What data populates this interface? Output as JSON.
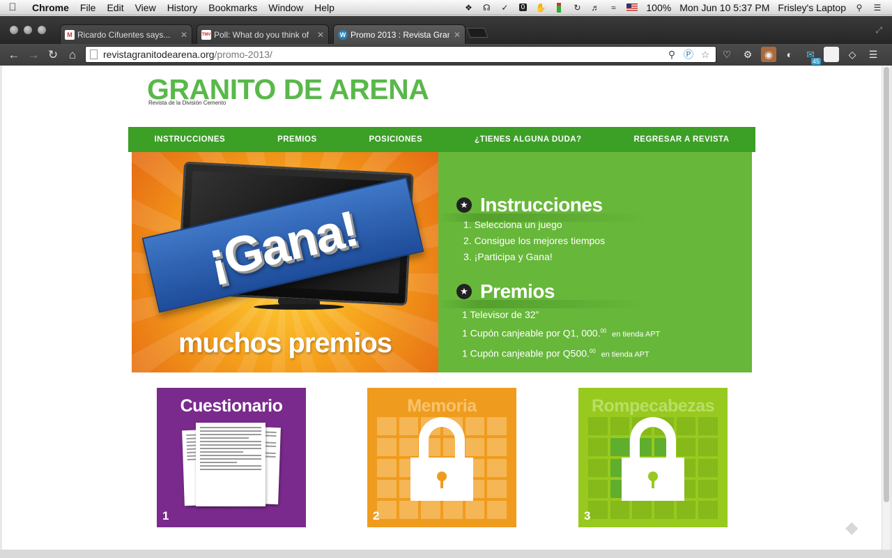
{
  "menubar": {
    "app": "Chrome",
    "items": [
      "File",
      "Edit",
      "View",
      "History",
      "Bookmarks",
      "Window",
      "Help"
    ],
    "status_icons": [
      "dropbox-icon",
      "headphones-icon",
      "tweet-icon",
      "zero-icon",
      "hand-icon",
      "battery-meter-icon",
      "sync-icon",
      "volume-icon",
      "wifi-icon"
    ],
    "battery": "100%",
    "datetime": "Mon Jun 10  5:37 PM",
    "user": "Frisley's Laptop"
  },
  "tabs": [
    {
      "title": "Ricardo Cifuentes says...",
      "favicon": "gmail-icon",
      "favicon_text": "M"
    },
    {
      "title": "Poll: What do you think of",
      "favicon": "tmv-icon",
      "favicon_text": "TMV"
    },
    {
      "title": "Promo 2013 : Revista Gran",
      "favicon": "wordpress-icon",
      "favicon_text": "W"
    }
  ],
  "address": {
    "domain": "revistagranitodearena.org",
    "path": "/promo-2013/"
  },
  "ext_badge": "45",
  "site": {
    "title": "GRANITO DE ARENA",
    "subtitle": "Revista de la División Cemento",
    "nav": [
      "INSTRUCCIONES",
      "PREMIOS",
      "POSICIONES",
      "¿TIENES ALGUNA DUDA?",
      "REGRESAR A REVISTA"
    ]
  },
  "hero": {
    "banner": "¡Gana!",
    "tagline": "muchos premios",
    "instructions_title": "Instrucciones",
    "instructions": [
      "1. Selecciona un juego",
      "2. Consigue los mejores tiempos",
      "3. ¡Participa y Gana!"
    ],
    "prizes_title": "Premios",
    "prizes": [
      {
        "main": "1 Televisor de 32”",
        "sup": "",
        "small": ""
      },
      {
        "main": "1 Cupón canjeable por Q1, 000.",
        "sup": "00",
        "small": "en tienda APT"
      },
      {
        "main": "1 Cupón canjeable por Q500.",
        "sup": "00",
        "small": "en tienda APT"
      }
    ]
  },
  "games": [
    {
      "title": "Cuestionario",
      "number": "1",
      "locked": false,
      "color": "#7a2a8c"
    },
    {
      "title": "Memoria",
      "number": "2",
      "locked": true,
      "color": "#ef9c1e"
    },
    {
      "title": "Rompecabezas",
      "number": "3",
      "locked": true,
      "color": "#97c91f"
    }
  ],
  "colors": {
    "brand_green": "#59b84a",
    "nav_green": "#3c9f26",
    "panel_green": "#67b73a"
  }
}
